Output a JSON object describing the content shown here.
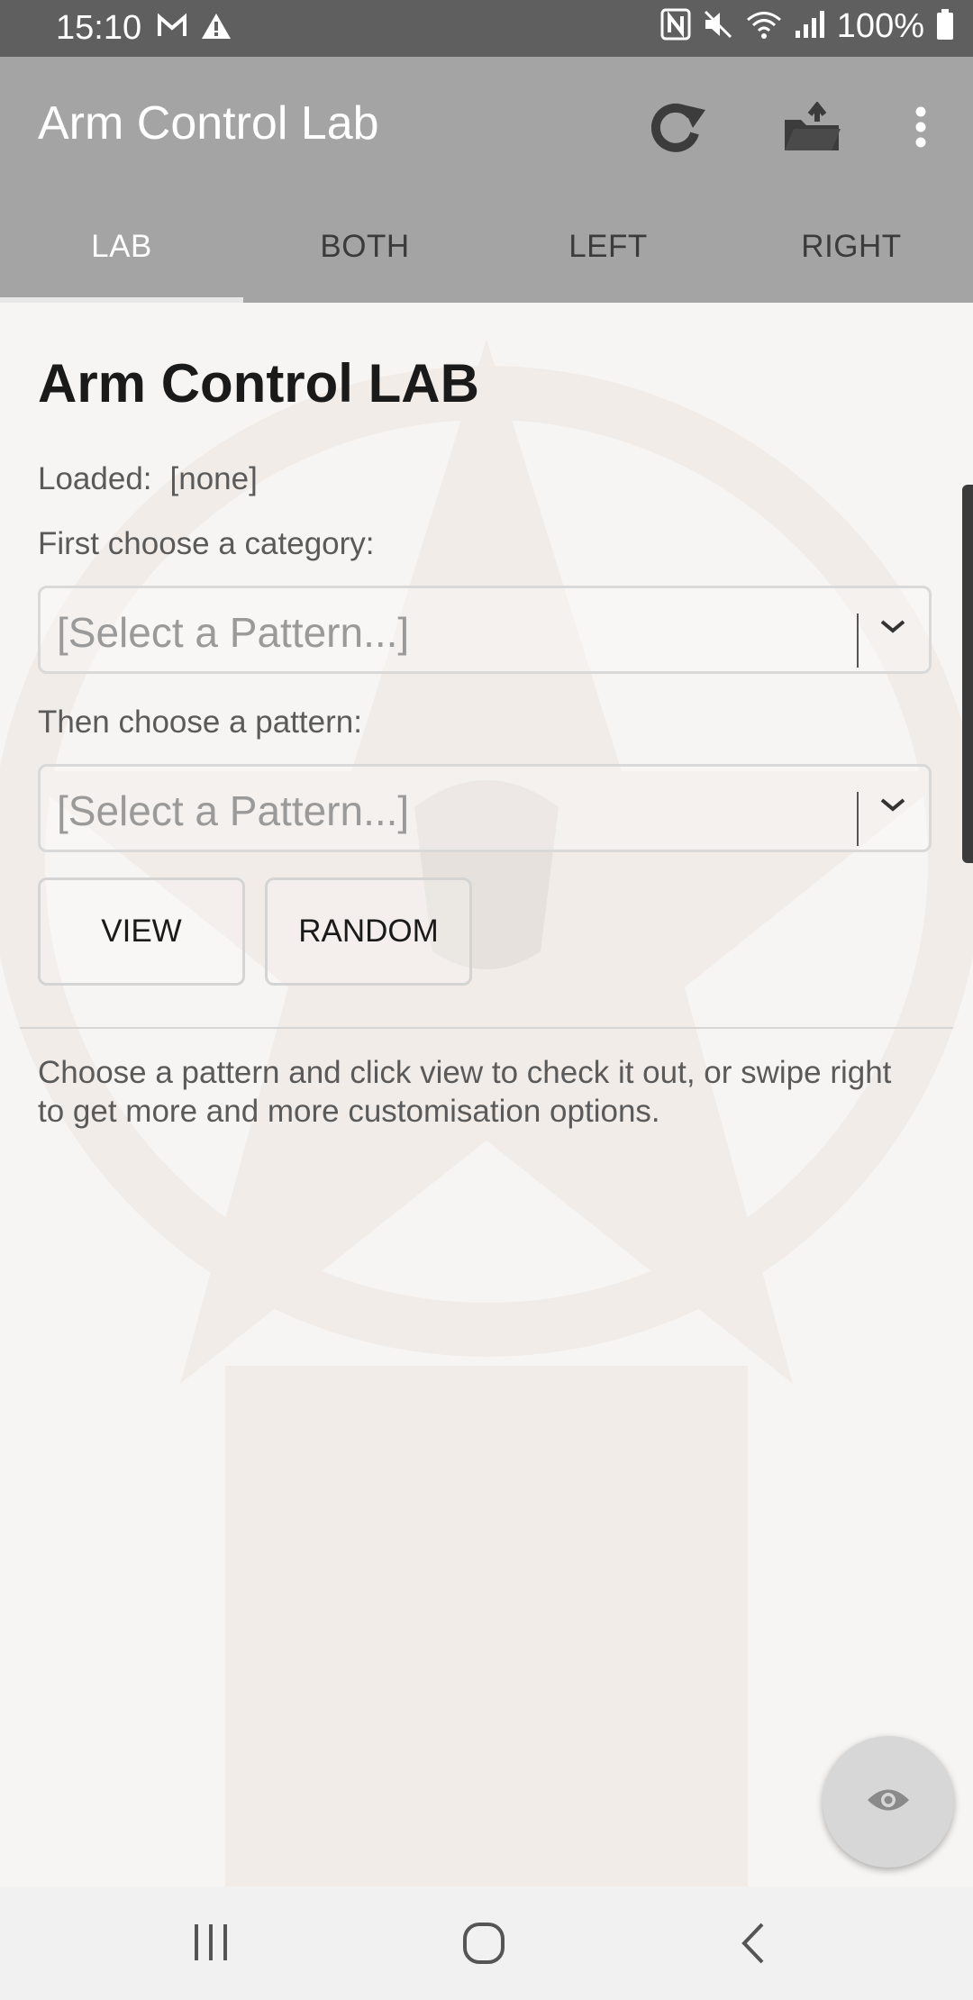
{
  "status_bar": {
    "time": "15:10",
    "battery": "100%",
    "icons": [
      "gmail-icon",
      "alert-icon",
      "nfc-icon",
      "mute-icon",
      "wifi-icon",
      "signal-icon",
      "battery-icon"
    ]
  },
  "app_bar": {
    "title": "Arm Control Lab",
    "actions": [
      "refresh-icon",
      "open-folder-icon",
      "more-vert-icon"
    ]
  },
  "tabs": [
    {
      "label": "LAB",
      "active": true
    },
    {
      "label": "BOTH",
      "active": false
    },
    {
      "label": "LEFT",
      "active": false
    },
    {
      "label": "RIGHT",
      "active": false
    }
  ],
  "main": {
    "title": "Arm Control LAB",
    "loaded_label": "Loaded:",
    "loaded_value": "[none]",
    "category_label": "First choose a category:",
    "category_select": {
      "value": "[Select a Pattern...]"
    },
    "pattern_label": "Then choose a pattern:",
    "pattern_select": {
      "value": "[Select a Pattern...]"
    },
    "buttons": {
      "view": "VIEW",
      "random": "RANDOM"
    },
    "help_text": "Choose a pattern and click view to check it out, or swipe right to get more and more customisation options."
  },
  "fab": {
    "icon": "eye-icon"
  },
  "nav_bar": {
    "buttons": [
      "recent-apps-icon",
      "home-icon",
      "back-icon"
    ]
  },
  "colors": {
    "status_bar": "#5f5f5f",
    "app_bar": "#a4a4a4",
    "background": "#f7f5f3",
    "fab": "#d7d7d7"
  }
}
